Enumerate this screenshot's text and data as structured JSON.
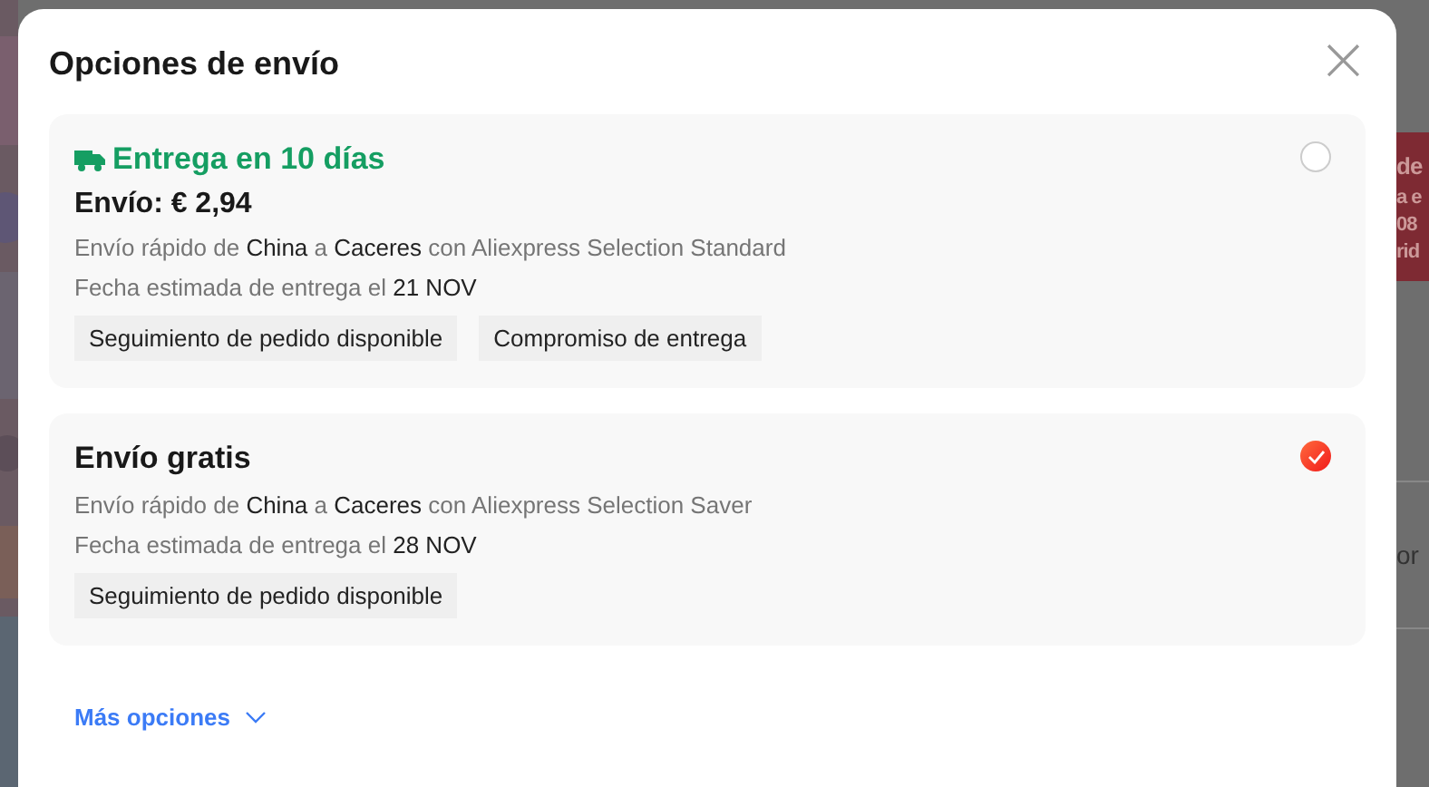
{
  "background": {
    "banner_lines": [
      "de",
      "a e",
      "08",
      "rid"
    ],
    "field_text": "or"
  },
  "dialog": {
    "title": "Opciones de envío",
    "close_label": "×",
    "options": [
      {
        "kind": "express",
        "headline": "Entrega en 10 días",
        "price": "Envío: € 2,94",
        "selected": false,
        "route": [
          {
            "text": "Envío rápido de ",
            "strong": false
          },
          {
            "text": "China",
            "strong": true
          },
          {
            "text": " a ",
            "strong": false
          },
          {
            "text": "Caceres",
            "strong": true
          },
          {
            "text": " con Aliexpress Selection Standard",
            "strong": false
          }
        ],
        "estimate": [
          {
            "text": "Fecha estimada de entrega el ",
            "strong": false
          },
          {
            "text": "21 NOV",
            "strong": true
          }
        ],
        "tags": [
          "Seguimiento de pedido disponible",
          "Compromiso de entrega"
        ]
      },
      {
        "kind": "free",
        "headline": "Envío gratis",
        "selected": true,
        "route": [
          {
            "text": "Envío rápido de ",
            "strong": false
          },
          {
            "text": "China",
            "strong": true
          },
          {
            "text": " a ",
            "strong": false
          },
          {
            "text": "Caceres",
            "strong": true
          },
          {
            "text": " con Aliexpress Selection Saver",
            "strong": false
          }
        ],
        "estimate": [
          {
            "text": "Fecha estimada de entrega el ",
            "strong": false
          },
          {
            "text": "28 NOV",
            "strong": true
          }
        ],
        "tags": [
          "Seguimiento de pedido disponible"
        ]
      }
    ],
    "more_link": "Más opciones"
  }
}
